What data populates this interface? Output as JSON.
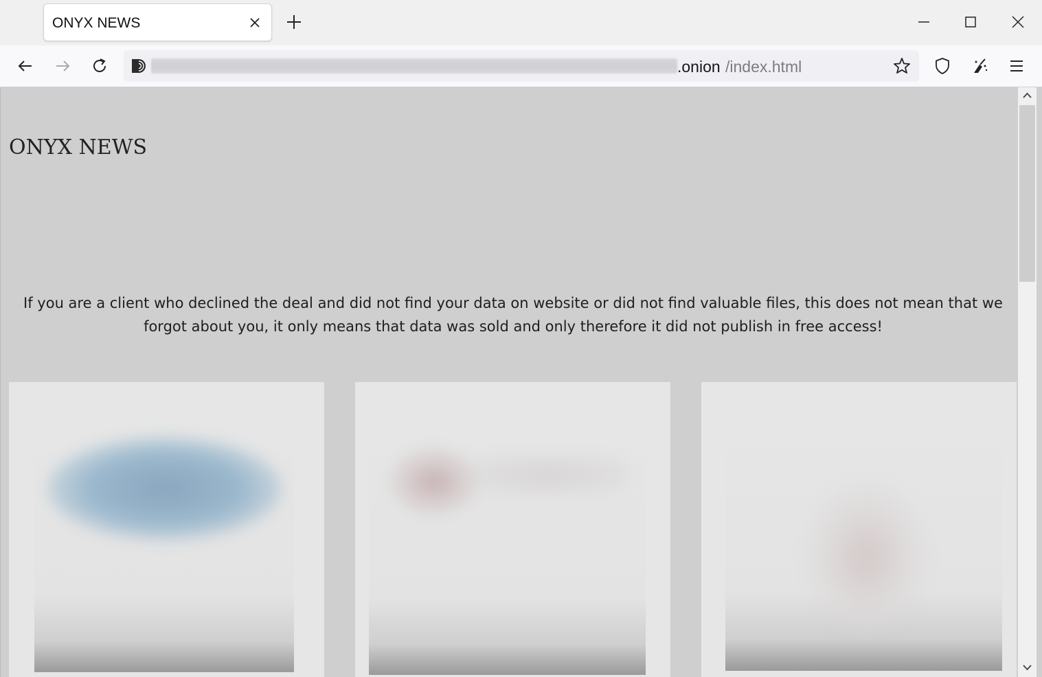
{
  "browser": {
    "tab": {
      "title": "ONYX NEWS",
      "close_icon": "close-icon"
    },
    "new_tab_icon": "plus-icon",
    "window_controls": [
      "minimize-icon",
      "maximize-icon",
      "close-icon"
    ],
    "toolbar": {
      "icons": [
        "back-arrow-icon",
        "forward-arrow-icon",
        "reload-icon",
        "bookmark-star-icon",
        "shield-icon",
        "magic-broom-icon",
        "hamburger-menu-icon"
      ]
    },
    "url": {
      "host": ".onion",
      "path": "/index.html",
      "site_icon": "onion-icon"
    }
  },
  "page": {
    "heading": "ONYX NEWS",
    "notice": "If you are a client who declined the deal and did not find your data on website or did not find valuable files, this does not mean that we forgot about you, it only means that data was sold and only therefore it did not publish in free access!",
    "background_color": "#cfcfcf",
    "card_color": "#e6e6e6"
  }
}
